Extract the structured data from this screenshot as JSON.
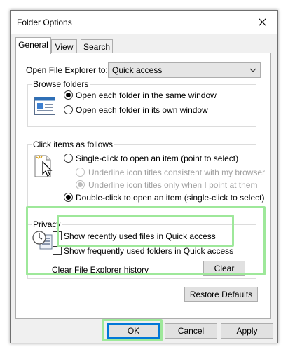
{
  "window": {
    "title": "Folder Options"
  },
  "tabs": [
    {
      "label": "General",
      "active": true
    },
    {
      "label": "View",
      "active": false
    },
    {
      "label": "Search",
      "active": false
    }
  ],
  "general": {
    "open_label": "Open File Explorer to:",
    "open_value": "Quick access",
    "browse": {
      "legend": "Browse folders",
      "same_window": "Open each folder in the same window",
      "own_window": "Open each folder in its own window"
    },
    "click": {
      "legend": "Click items as follows",
      "single_click": "Single-click to open an item (point to select)",
      "underline_consistent": "Underline icon titles consistent with my browser",
      "underline_point": "Underline icon titles only when I point at them",
      "double_click": "Double-click to open an item (single-click to select)"
    },
    "privacy": {
      "legend": "Privacy",
      "recent_files": "Show recently used files in Quick access",
      "frequent_folders": "Show frequently used folders in Quick access",
      "clear_label": "Clear File Explorer history",
      "clear_button": "Clear"
    },
    "restore_defaults": "Restore Defaults"
  },
  "footer": {
    "ok": "OK",
    "cancel": "Cancel",
    "apply": "Apply"
  },
  "colors": {
    "highlight": "#9ee89a",
    "accent": "#0078d7"
  }
}
